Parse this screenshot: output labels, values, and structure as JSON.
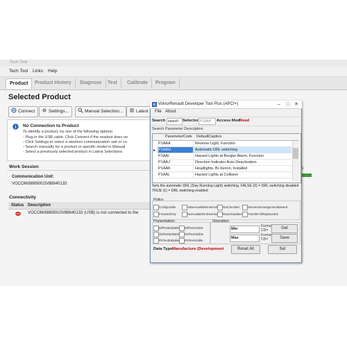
{
  "main_window": {
    "title": "Tech Tool",
    "menu": [
      "Tech Tool",
      "Links",
      "Help"
    ],
    "tabs": [
      "Product",
      "Product History",
      "Diagnose",
      "Test",
      "Calibrate",
      "Program"
    ],
    "active_tab": "Product",
    "page_title": "Selected Product",
    "toolbar": {
      "connect": "Connect",
      "settings": "Settings...",
      "manual_selection": "Manual Selection...",
      "latest": "Latest Se"
    },
    "info": {
      "title": "No Connection to Product",
      "lines": [
        "To identify a product, try one of the following options:",
        "- Plug in the USB cable. Click Connect if the readout does no",
        "- Click Settings to select a wireless communication unit or co",
        "- Search manually for a product or specific model in Manual",
        "- Select a previously selected product in Latest Selections."
      ]
    },
    "work_session": {
      "title": "Work Session",
      "comm_label": "Communication Unit:",
      "comm_value": "VOCOM/88890020/88840133"
    },
    "connectivity": {
      "title": "Connectivity",
      "columns": [
        "Status",
        "Description"
      ],
      "row": "VOCOM/88890020/88840133 (USB) is not connected to the"
    },
    "right_percent": "%"
  },
  "dialog": {
    "title": "Volvo/Renault Developer Tool Plus (APCI+)",
    "menu": [
      "File",
      "About"
    ],
    "search_label": "Search",
    "search_value": "search",
    "selector_label": "Selector",
    "selector_value": "P1AAH",
    "access_label": "Access Mod",
    "access_value": "Read",
    "search_desc_label": "Search Parameter Description",
    "grid_columns": [
      "ParameterCode",
      "DefaultCaption"
    ],
    "grid_rows": [
      {
        "code": "P1AAA",
        "caption": "Reverse Light, Function"
      },
      {
        "code": "P1AAH",
        "caption": "Automatic DRL switching"
      },
      {
        "code": "P1AAI",
        "caption": "Hazard Lights at Burglar Alarm, Function"
      },
      {
        "code": "P1AAJ",
        "caption": "Direction Indicator Auto Deactivation"
      },
      {
        "code": "P1AAK",
        "caption": "Headlights, Bi-Xenon, Installed"
      },
      {
        "code": "P1AAL",
        "caption": "Hazard Lights at Collision"
      }
    ],
    "selected_row": 1,
    "description": "Sets the automatic DRL (Day Running Light) switching. FALSE   (0) = DRL switching disabled TRUE   (1) = DRL switching enabled",
    "policy_label": "Policy",
    "policy_items": [
      "Configurable",
      "ValueAvailableInImmobi",
      "NotChecked",
      "Elementsmanagement&lowed",
      "ForwardOnly",
      "NotAvailableInDownload",
      "ReportUpdates",
      "TransferAllReplacedUs"
    ],
    "presentation_label": "Presentation",
    "presentation_items": [
      "DiffTestEditable",
      "DiffTestVisible",
      "OldTestEditable",
      "OldTestVisible",
      "PDTextEditable",
      "PDTextVisible"
    ],
    "operation_label": "Operation",
    "min_label": "Min",
    "max_label": "Max",
    "formula_label": "Formula:",
    "formula_sub": "CD=",
    "buttons": {
      "get": "Get",
      "save": "Save",
      "reset": "Reset All",
      "set": "Set"
    },
    "data_type_label": "Data Type",
    "data_type_value": "Manufacture (Development"
  },
  "colors": {
    "accent_red": "#c00000",
    "selected_blue": "#3d7fd6",
    "status_red": "#d40000"
  }
}
